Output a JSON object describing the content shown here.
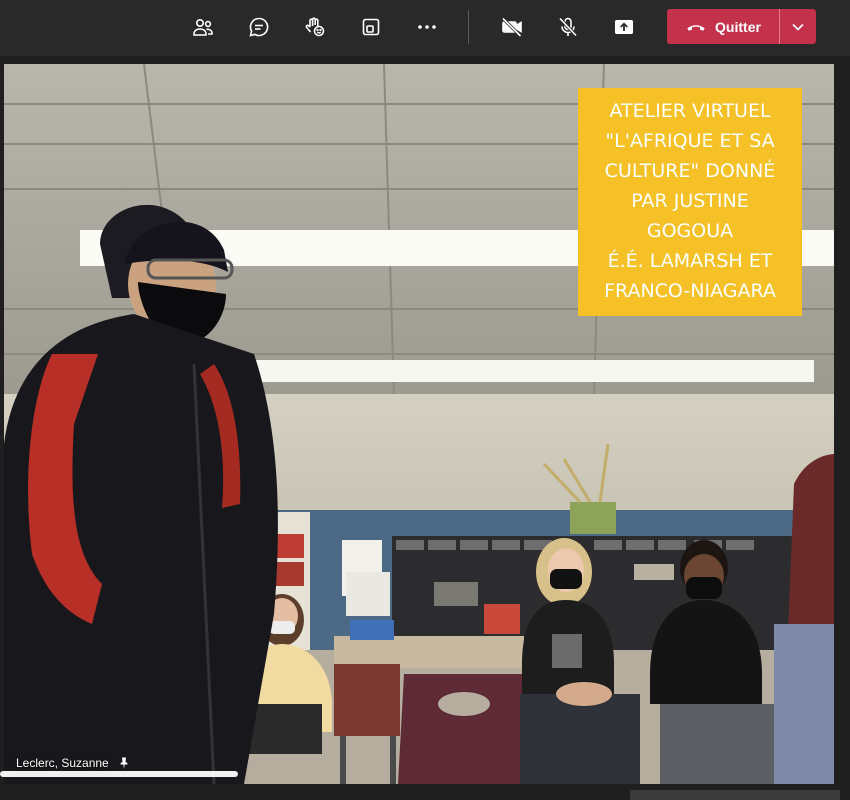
{
  "toolbar": {
    "icons": [
      "participants-icon",
      "chat-icon",
      "reactions-icon",
      "share-tray-icon",
      "more-options-icon",
      "camera-off-icon",
      "mic-muted-icon",
      "share-screen-icon"
    ],
    "leave_label": "Quitter",
    "leave_color": "#c4314b"
  },
  "video": {
    "caption": {
      "lines": [
        "ATELIER VIRTUEL",
        "\"L'AFRIQUE ET SA",
        "CULTURE\" DONNÉ",
        "PAR JUSTINE",
        "GOGOUA",
        "É.É. LAMARSH ET",
        "FRANCO-NIAGARA"
      ],
      "background_color": "#f6c126"
    },
    "participant_name": "Leclerc, Suzanne",
    "pinned": true,
    "progress_fraction": 0.28
  }
}
